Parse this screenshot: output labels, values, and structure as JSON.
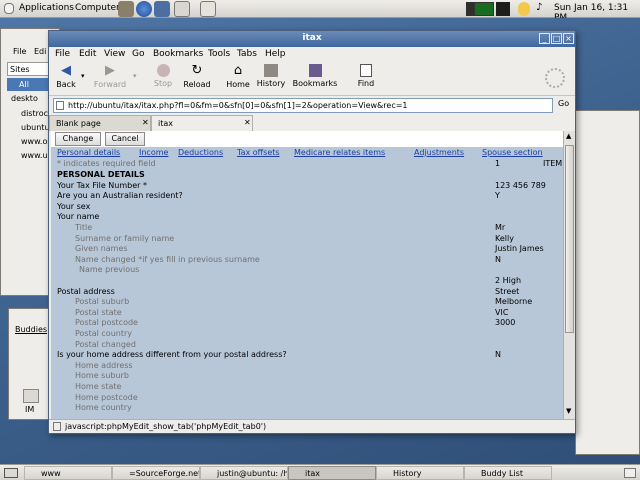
{
  "top_panel": {
    "applications": "Applications",
    "computer": "Computer",
    "clock": "Sun Jan 16,  1:31 PM"
  },
  "bg_window": {
    "menu_file": "File",
    "menu_edit": "Edi",
    "sites_label": "Sites",
    "all_label": "All",
    "items": [
      "deskto",
      "distroc",
      "ubuntu",
      "www.os",
      "www.ub"
    ]
  },
  "buddy_window": {
    "label": "Buddies",
    "im_label": "IM"
  },
  "browser": {
    "title": "itax",
    "menu": [
      "File",
      "Edit",
      "View",
      "Go",
      "Bookmarks",
      "Tools",
      "Tabs",
      "Help"
    ],
    "toolbar": {
      "back": "Back",
      "forward": "Forward",
      "stop": "Stop",
      "reload": "Reload",
      "home": "Home",
      "history": "History",
      "bookmarks": "Bookmarks",
      "find": "Find"
    },
    "url": "http://ubuntu/itax/itax.php?fl=0&fm=0&sfn[0]=0&sfn[1]=2&operation=View&rec=1",
    "go": "Go",
    "tabs": [
      "Blank page",
      "itax"
    ],
    "status": "javascript:phpMyEdit_show_tab('phpMyEdit_tab0')"
  },
  "form": {
    "buttons": {
      "change": "Change",
      "cancel": "Cancel"
    },
    "tab_links": [
      "Personal details",
      "Income",
      "Deductions",
      "Tax offsets",
      "Medicare relates items",
      "Adjustments",
      "Spouse section"
    ],
    "record_num": "1",
    "record_label": "ITEM",
    "required_note": "* indicates required field",
    "rows": [
      {
        "label": "PERSONAL DETAILS",
        "value": "",
        "indent": 0,
        "bold": true
      },
      {
        "label": "Your Tax File Number *",
        "value": "123 456 789",
        "indent": 0
      },
      {
        "label": "Are you an Australian resident?",
        "value": "Y",
        "indent": 0
      },
      {
        "label": "Your sex",
        "value": "",
        "indent": 0
      },
      {
        "label": "Your name",
        "value": "",
        "indent": 0
      },
      {
        "label": "Title",
        "value": "Mr",
        "indent": 1
      },
      {
        "label": "Surname or family name",
        "value": "Kelly",
        "indent": 1
      },
      {
        "label": "Given names",
        "value": "Justin James",
        "indent": 1
      },
      {
        "label": "Name changed *if yes fill in previous surname",
        "value": "N",
        "indent": 1
      },
      {
        "label": "Name previous",
        "value": "",
        "indent": 2
      },
      {
        "label": "",
        "value": "2 High",
        "indent": 0
      },
      {
        "label": "Postal address",
        "value": "Street",
        "indent": 0
      },
      {
        "label": "Postal suburb",
        "value": "Melborne",
        "indent": 1
      },
      {
        "label": "Postal state",
        "value": "VIC",
        "indent": 1
      },
      {
        "label": "Postal postcode",
        "value": "3000",
        "indent": 1
      },
      {
        "label": "Postal country",
        "value": "",
        "indent": 1
      },
      {
        "label": "Postal changed",
        "value": "",
        "indent": 1
      },
      {
        "label": "Is your home address different from your postal address?",
        "value": "N",
        "indent": 0
      },
      {
        "label": "Home address",
        "value": "",
        "indent": 1
      },
      {
        "label": "Home suburb",
        "value": "",
        "indent": 1
      },
      {
        "label": "Home state",
        "value": "",
        "indent": 1
      },
      {
        "label": "Home postcode",
        "value": "",
        "indent": 1
      },
      {
        "label": "Home country",
        "value": "",
        "indent": 1
      }
    ]
  },
  "taskbar": [
    "www",
    "=SourceForge.net",
    "justin@ubuntu: /ho",
    "itax",
    "History",
    "Buddy List"
  ]
}
